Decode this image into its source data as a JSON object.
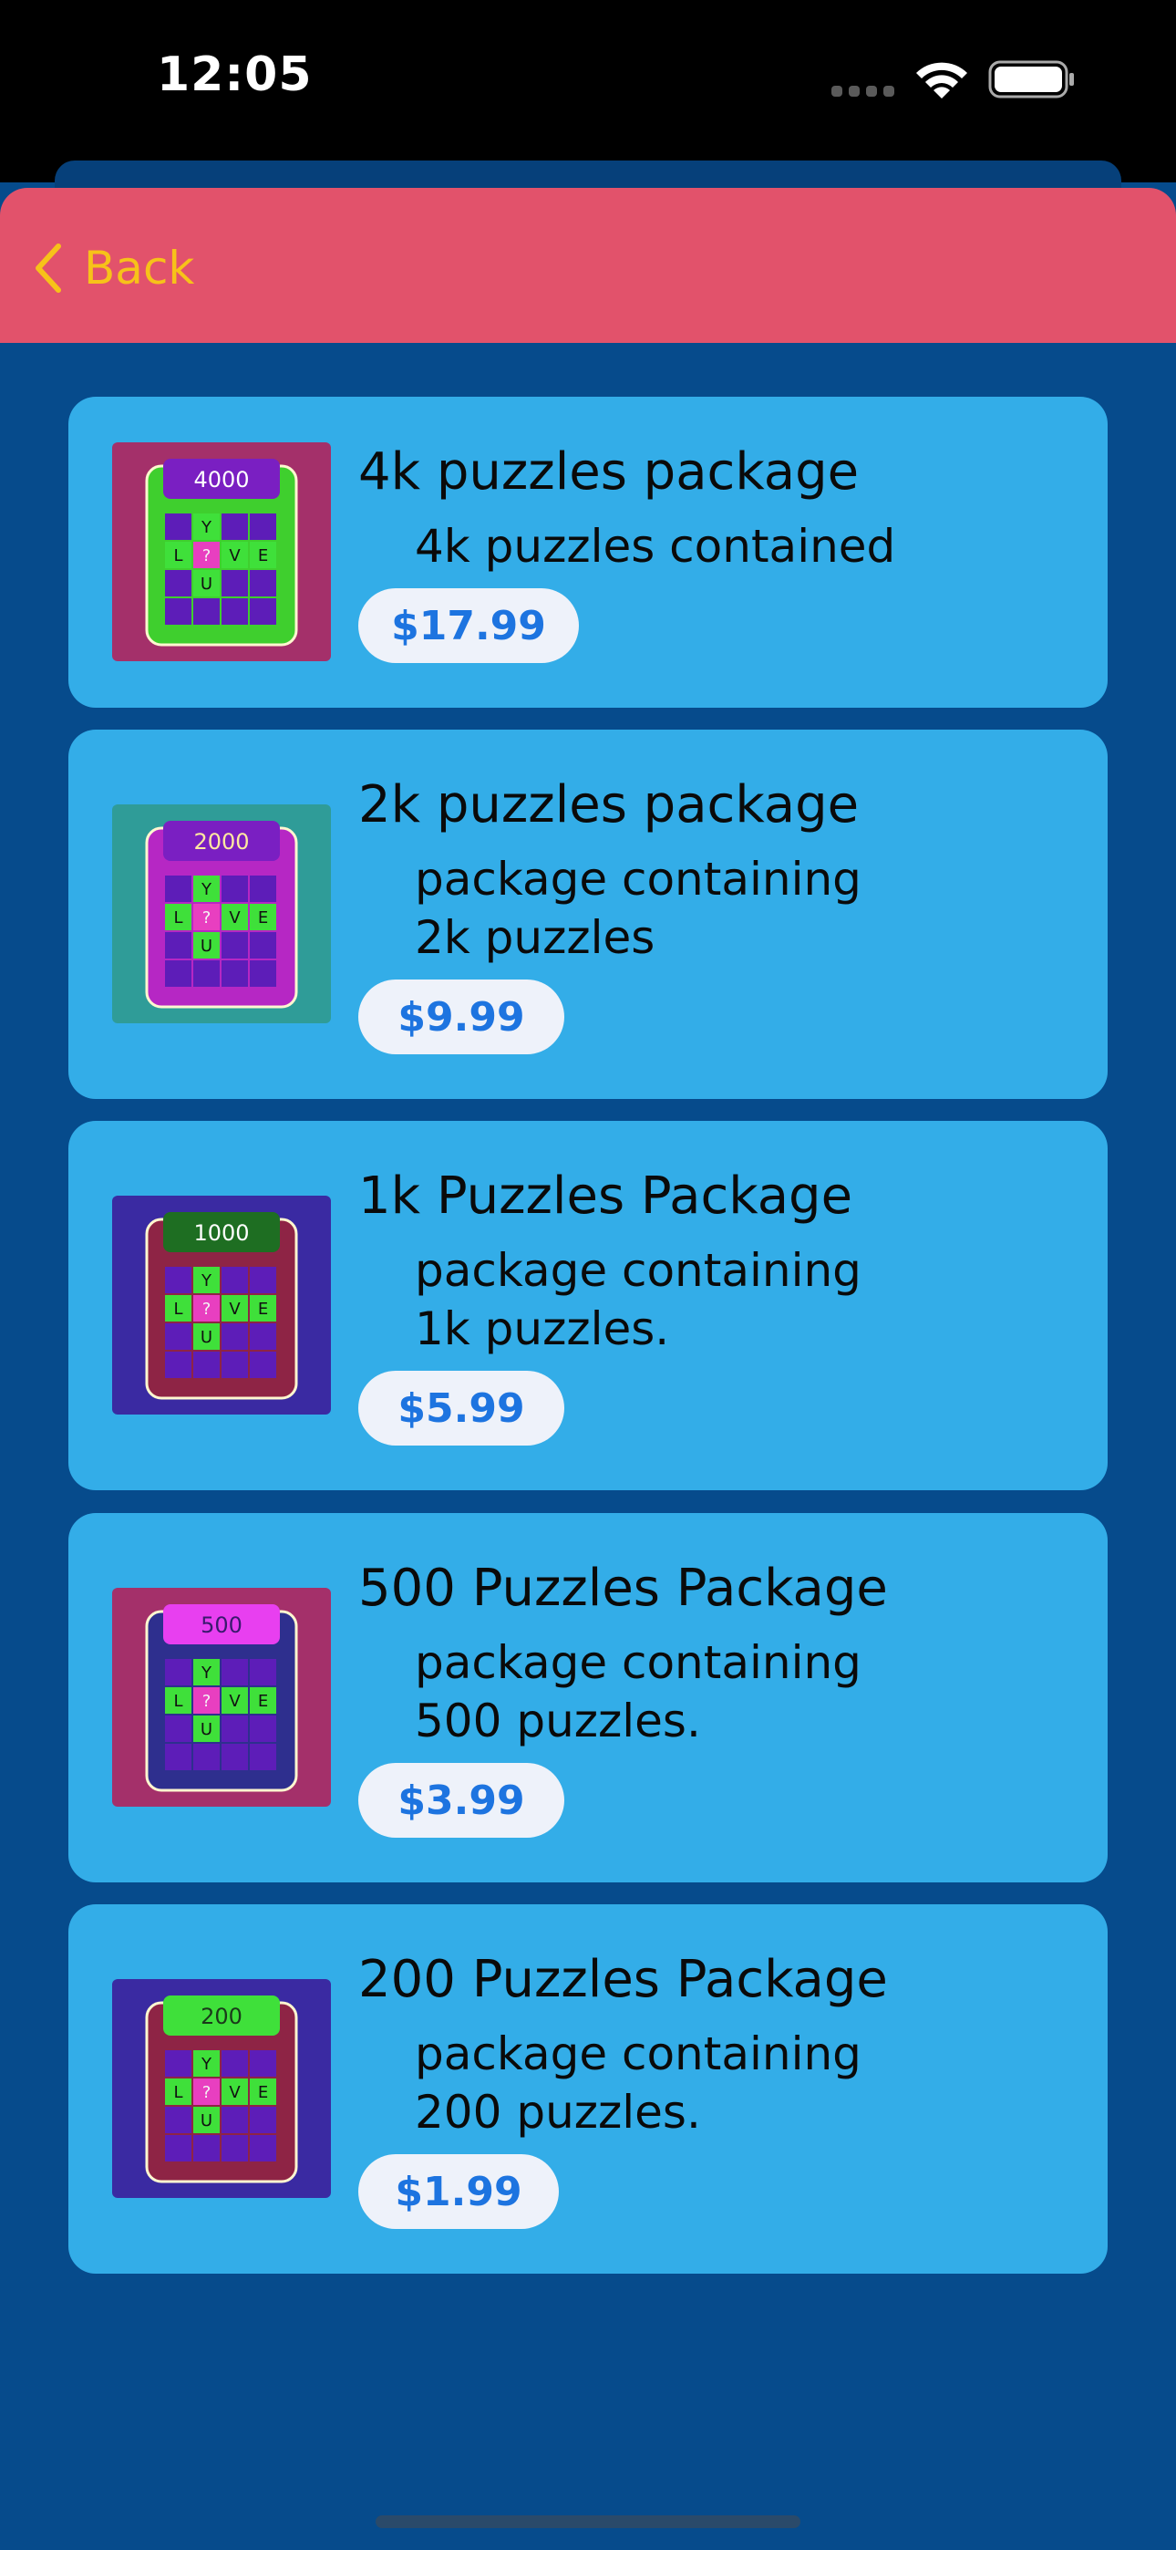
{
  "status_bar": {
    "time": "12:05"
  },
  "nav": {
    "back_label": "Back"
  },
  "colors": {
    "background": "#064b8c",
    "nav_bar": "#e2526b",
    "back_accent": "#f7c219",
    "card": "#33ade8",
    "price_text": "#1d74e0",
    "price_pill": "#eef2fa"
  },
  "packages": [
    {
      "title": "4k puzzles package",
      "desc_lines": [
        "4k puzzles contained"
      ],
      "price": "$17.99",
      "thumb": {
        "count_label": "4000",
        "letters": [
          "Y",
          "L",
          "?",
          "V",
          "E",
          "U"
        ],
        "frame_color": "#a4306a",
        "board_color": "#3fcf2e",
        "tab_color": "#7a1fc2",
        "tab_text_color": "#ffffff",
        "cell_color": "#5d1db8"
      }
    },
    {
      "title": "2k puzzles package",
      "desc_lines": [
        "package containing",
        "2k puzzles"
      ],
      "price": "$9.99",
      "thumb": {
        "count_label": "2000",
        "letters": [
          "Y",
          "L",
          "?",
          "V",
          "E",
          "U"
        ],
        "frame_color": "#2f9c98",
        "board_color": "#b627c4",
        "tab_color": "#7a1fc2",
        "tab_text_color": "#ffe9a0",
        "cell_color": "#5d1db8"
      }
    },
    {
      "title": "1k Puzzles Package",
      "desc_lines": [
        "package containing",
        "1k puzzles."
      ],
      "price": "$5.99",
      "thumb": {
        "count_label": "1000",
        "letters": [
          "Y",
          "L",
          "?",
          "V",
          "E",
          "U"
        ],
        "frame_color": "#3a2aa2",
        "board_color": "#8e2445",
        "tab_color": "#1e6e22",
        "tab_text_color": "#ffffff",
        "cell_color": "#5d1db8"
      }
    },
    {
      "title": "500 Puzzles Package",
      "desc_lines": [
        "package containing",
        "500 puzzles."
      ],
      "price": "$3.99",
      "thumb": {
        "count_label": "500",
        "letters": [
          "Y",
          "L",
          "?",
          "V",
          "E",
          "U"
        ],
        "frame_color": "#a4306a",
        "board_color": "#2e2f8e",
        "tab_color": "#e83ff0",
        "tab_text_color": "#3a1a6e",
        "cell_color": "#5d1db8"
      }
    },
    {
      "title": "200 Puzzles Package",
      "desc_lines": [
        "package containing",
        "200 puzzles."
      ],
      "price": "$1.99",
      "thumb": {
        "count_label": "200",
        "letters": [
          "Y",
          "L",
          "?",
          "V",
          "E",
          "U"
        ],
        "frame_color": "#3a2aa2",
        "board_color": "#8e2445",
        "tab_color": "#3fe03a",
        "tab_text_color": "#1a3a1a",
        "cell_color": "#5d1db8"
      }
    }
  ]
}
